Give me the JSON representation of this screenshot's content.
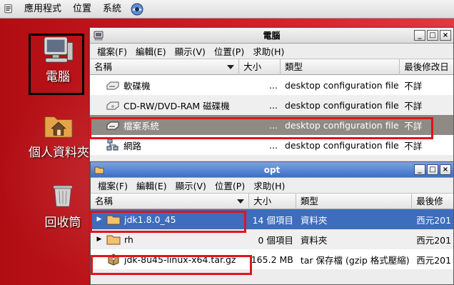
{
  "top_panel": {
    "menus": [
      "應用程式",
      "位置",
      "系統"
    ],
    "hat_icon": "redhat-icon"
  },
  "desktop": {
    "icons": [
      {
        "label": "電腦",
        "icon": "computer-icon"
      },
      {
        "label": "個人資料夾",
        "icon": "home-folder-icon"
      },
      {
        "label": "回收筒",
        "icon": "trash-icon"
      }
    ]
  },
  "computer_window": {
    "title": "電腦",
    "menus": [
      "檔案(F)",
      "編輯(E)",
      "顯示(V)",
      "位置(P)",
      "求助(H)"
    ],
    "columns": [
      "名稱",
      "大小",
      "類型",
      "最後修改日"
    ],
    "rows": [
      {
        "name": "軟碟機",
        "size": "...",
        "type": "desktop configuration file",
        "modified": "不詳",
        "icon": "floppy-drive-icon"
      },
      {
        "name": "CD-RW/DVD-RAM 磁碟機",
        "size": "...",
        "type": "desktop configuration file",
        "modified": "不詳",
        "icon": "optical-drive-icon"
      },
      {
        "name": "檔案系統",
        "size": "...",
        "type": "desktop configuration file",
        "modified": "不詳",
        "icon": "filesystem-icon"
      },
      {
        "name": "網路",
        "size": "...",
        "type": "desktop configuration file",
        "modified": "不詳",
        "icon": "network-icon"
      }
    ]
  },
  "opt_window": {
    "title": "opt",
    "menus": [
      "檔案(F)",
      "編輯(E)",
      "顯示(V)",
      "位置(P)",
      "求助(H)"
    ],
    "columns": [
      "名稱",
      "大小",
      "類型",
      "最後修"
    ],
    "rows": [
      {
        "expander": "▶",
        "name": "jdk1.8.0_45",
        "size": "14 個項目",
        "type": "資料夾",
        "modified": "西元201",
        "icon": "folder-icon"
      },
      {
        "expander": "▶",
        "name": "rh",
        "size": "0 個項目",
        "type": "資料夾",
        "modified": "西元201",
        "icon": "folder-icon"
      },
      {
        "expander": "",
        "name": "jdk-8u45-linux-x64.tar.gz",
        "size": "165.2 MB",
        "type": "tar 保存檔 (gzip 格式壓縮)",
        "modified": "西元201",
        "icon": "archive-icon"
      }
    ]
  },
  "colors": {
    "desktop_red": "#c8171c",
    "highlight_box": "#e0141b",
    "selection_blue": "#3d6dbc",
    "selection_gray": "#8f8a84"
  }
}
